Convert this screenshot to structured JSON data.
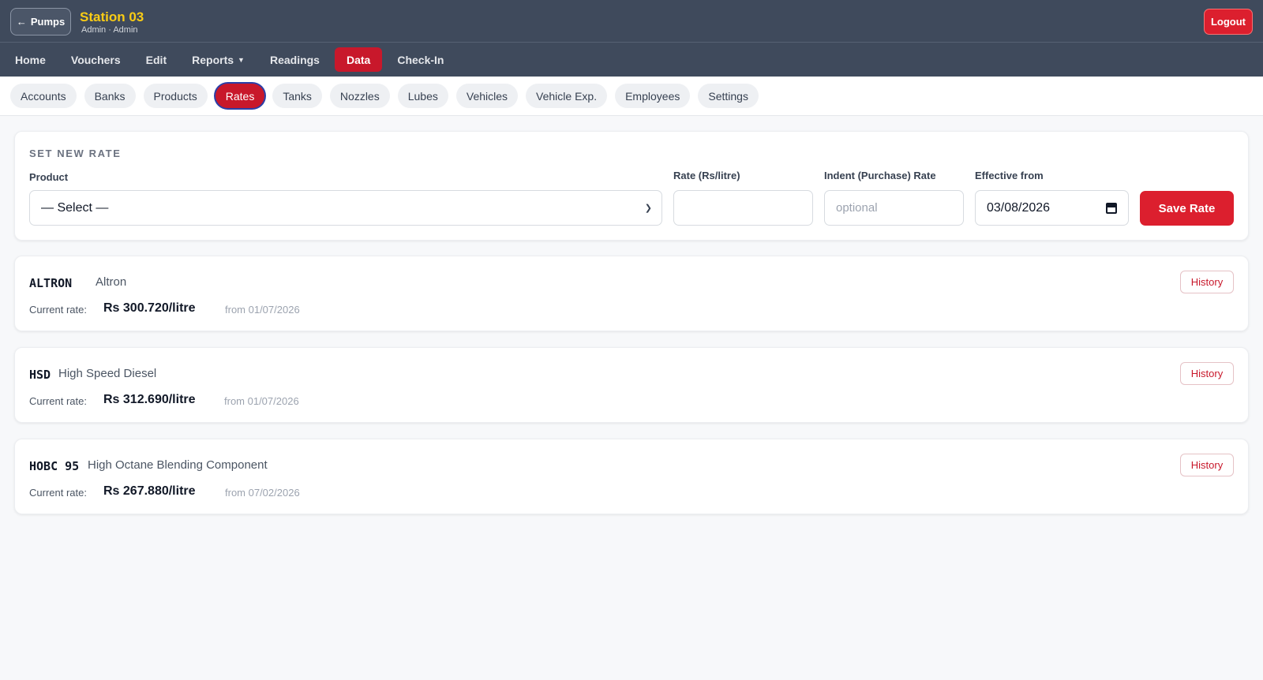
{
  "header": {
    "back_label": "Pumps",
    "station_title": "Station 03",
    "station_sub": "Admin · Admin",
    "logout_label": "Logout"
  },
  "mainnav": {
    "items": [
      {
        "label": "Home"
      },
      {
        "label": "Vouchers"
      },
      {
        "label": "Edit"
      },
      {
        "label": "Reports"
      },
      {
        "label": "Readings"
      },
      {
        "label": "Data",
        "active": true
      },
      {
        "label": "Check-In"
      }
    ]
  },
  "subnav": {
    "items": [
      {
        "label": "Accounts"
      },
      {
        "label": "Banks"
      },
      {
        "label": "Products"
      },
      {
        "label": "Rates",
        "active": true
      },
      {
        "label": "Tanks"
      },
      {
        "label": "Nozzles"
      },
      {
        "label": "Lubes"
      },
      {
        "label": "Vehicles"
      },
      {
        "label": "Vehicle Exp."
      },
      {
        "label": "Employees"
      },
      {
        "label": "Settings"
      }
    ]
  },
  "form": {
    "section_title": "SET NEW RATE",
    "product_label": "Product",
    "product_value": "— Select —",
    "rate_label": "Rate (Rs/litre)",
    "rate_value": "",
    "indent_label": "Indent (Purchase) Rate",
    "indent_placeholder": "optional",
    "effective_label": "Effective from",
    "effective_value": "03/08/2026",
    "save_label": "Save Rate"
  },
  "rates": [
    {
      "code": "ALTRON",
      "name": "Altron",
      "current_label": "Current rate:",
      "rate": "Rs 300.720/litre",
      "from": "from 01/07/2026",
      "history_label": "History"
    },
    {
      "code": "HSD",
      "name": "High Speed Diesel",
      "current_label": "Current rate:",
      "rate": "Rs 312.690/litre",
      "from": "from 01/07/2026",
      "history_label": "History"
    },
    {
      "code": "HOBC 95",
      "name": "High Octane Blending Component",
      "current_label": "Current rate:",
      "rate": "Rs 267.880/litre",
      "from": "from 07/02/2026",
      "history_label": "History"
    }
  ],
  "colors": {
    "topbar": "#3f4a5c",
    "accent": "#dc1f2e",
    "title": "#facc15"
  }
}
